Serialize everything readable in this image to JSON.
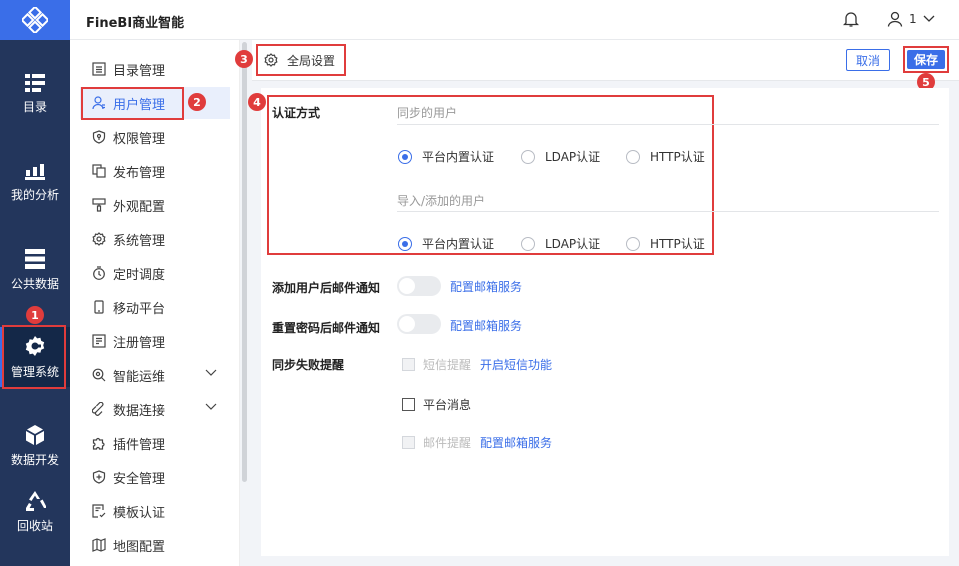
{
  "app": {
    "brand": "FineBI商业智能",
    "user_name": "1"
  },
  "nav": {
    "items": [
      {
        "label": "目录",
        "icon": "catalog-icon"
      },
      {
        "label": "我的分析",
        "icon": "chart-icon"
      },
      {
        "label": "公共数据",
        "icon": "database-icon"
      },
      {
        "label": "管理系统",
        "icon": "gear-icon"
      },
      {
        "label": "数据开发",
        "icon": "cube-icon"
      },
      {
        "label": "回收站",
        "icon": "recycle-icon"
      }
    ]
  },
  "sidebar": {
    "items": [
      {
        "label": "目录管理",
        "icon": "list-icon"
      },
      {
        "label": "用户管理",
        "icon": "user-icon"
      },
      {
        "label": "权限管理",
        "icon": "shield-icon"
      },
      {
        "label": "发布管理",
        "icon": "copy-icon"
      },
      {
        "label": "外观配置",
        "icon": "brush-icon"
      },
      {
        "label": "系统管理",
        "icon": "gear-icon"
      },
      {
        "label": "定时调度",
        "icon": "timer-icon"
      },
      {
        "label": "移动平台",
        "icon": "mobile-icon"
      },
      {
        "label": "注册管理",
        "icon": "register-icon"
      },
      {
        "label": "智能运维",
        "icon": "search-gear-icon"
      },
      {
        "label": "数据连接",
        "icon": "link-icon"
      },
      {
        "label": "插件管理",
        "icon": "puzzle-icon"
      },
      {
        "label": "安全管理",
        "icon": "shield-plus-icon"
      },
      {
        "label": "模板认证",
        "icon": "template-icon"
      },
      {
        "label": "地图配置",
        "icon": "map-icon"
      }
    ]
  },
  "tab": {
    "label": "全局设置"
  },
  "toolbar": {
    "cancel_label": "取消",
    "save_label": "保存"
  },
  "auth": {
    "title": "认证方式",
    "sync_label": "同步的用户",
    "import_label": "导入/添加的用户",
    "options": [
      "平台内置认证",
      "LDAP认证",
      "HTTP认证"
    ]
  },
  "settings": {
    "add_user_label": "添加用户后邮件通知",
    "reset_pwd_label": "重置密码后邮件通知",
    "mail_link": "配置邮箱服务",
    "sync_fail_label": "同步失败提醒",
    "sms_label": "短信提醒",
    "sms_link": "开启短信功能",
    "platform_msg_label": "平台消息",
    "mail_remind_label": "邮件提醒",
    "mail_remind_link": "配置邮箱服务"
  },
  "badges": [
    "1",
    "2",
    "3",
    "4",
    "5"
  ],
  "colors": {
    "nav_bg": "#23365c",
    "accent": "#3a6ee8",
    "highlight": "#e03c3c"
  }
}
